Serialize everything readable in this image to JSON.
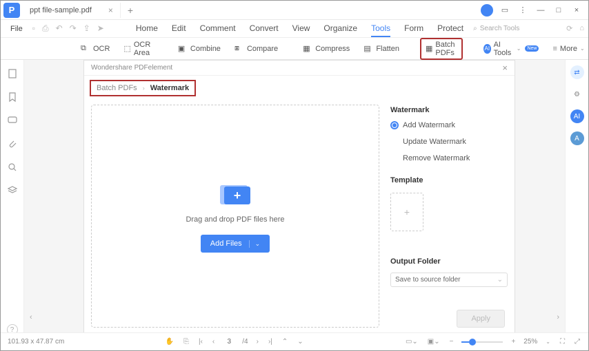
{
  "app_logo_letter": "P",
  "tab": {
    "title": "ppt file-sample.pdf"
  },
  "file_menu": "File",
  "menu": {
    "home": "Home",
    "edit": "Edit",
    "comment": "Comment",
    "convert": "Convert",
    "view": "View",
    "organize": "Organize",
    "tools": "Tools",
    "form": "Form",
    "protect": "Protect"
  },
  "search_placeholder": "Search Tools",
  "toolbar": {
    "ocr": "OCR",
    "ocr_area": "OCR Area",
    "combine": "Combine",
    "compare": "Compare",
    "compress": "Compress",
    "flatten": "Flatten",
    "batch_pdfs": "Batch PDFs",
    "ai_tools": "AI Tools",
    "new_badge": "New",
    "more": "More"
  },
  "panel": {
    "app_title": "Wondershare PDFelement",
    "breadcrumb1": "Batch PDFs",
    "breadcrumb2": "Watermark",
    "drop_text": "Drag and drop PDF files here",
    "add_files": "Add Files",
    "watermark_section": "Watermark",
    "opt_add": "Add Watermark",
    "opt_update": "Update Watermark",
    "opt_remove": "Remove Watermark",
    "template_section": "Template",
    "output_section": "Output Folder",
    "output_value": "Save to source folder",
    "apply": "Apply"
  },
  "status": {
    "dimensions": "101.93 x 47.87 cm",
    "page_current": "3",
    "page_total": "/4",
    "zoom": "25%"
  }
}
